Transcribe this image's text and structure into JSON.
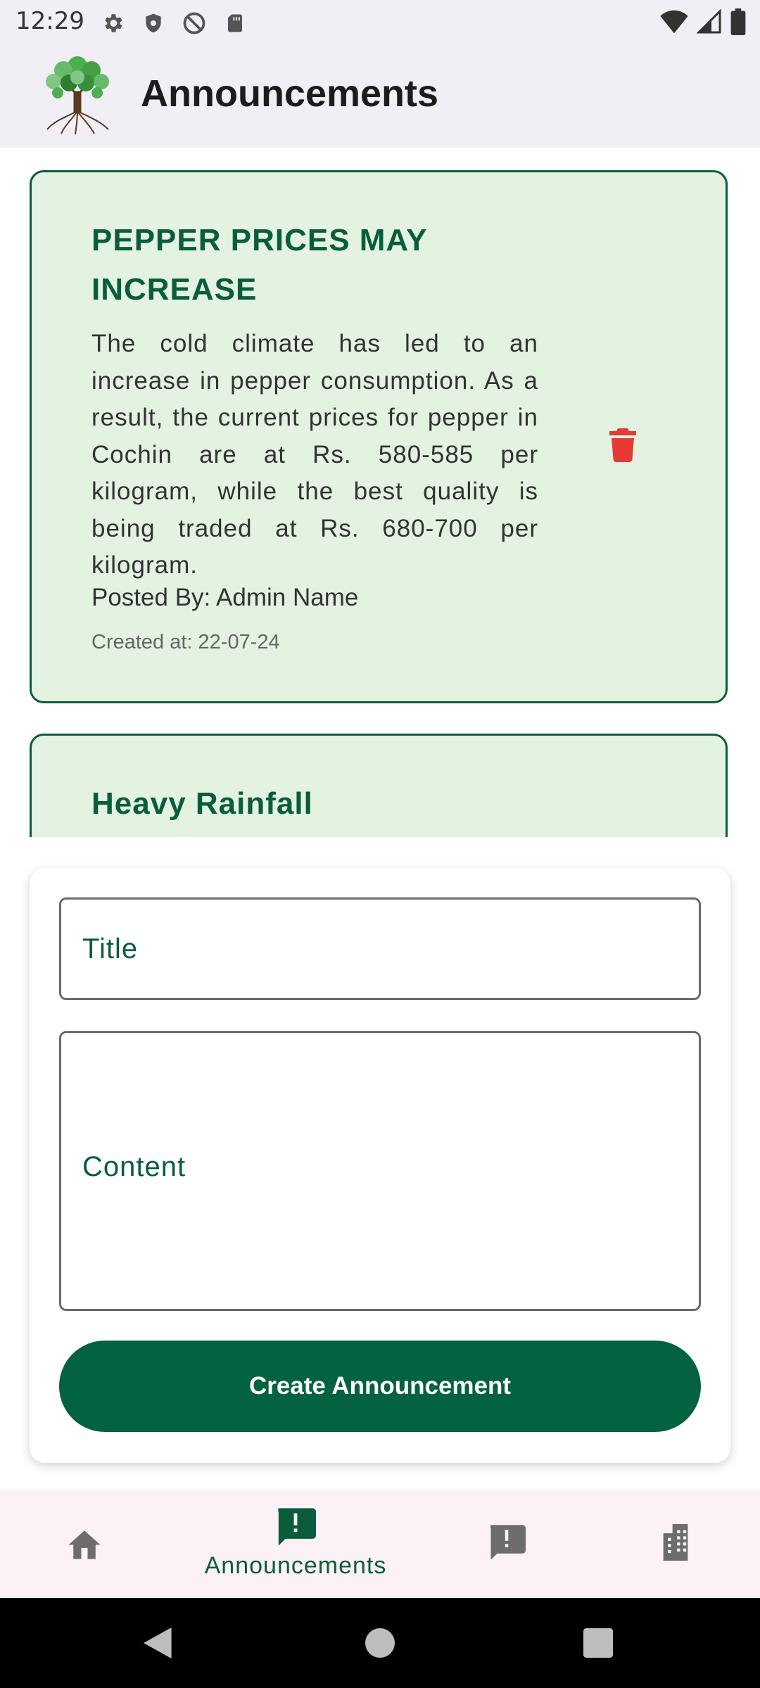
{
  "status_bar": {
    "time": "12:29",
    "left_icons": [
      "gear-icon",
      "shield-icon",
      "no-disturb-icon",
      "sd-card-icon"
    ],
    "right_icons": [
      "wifi-icon",
      "signal-icon",
      "battery-icon"
    ]
  },
  "app_bar": {
    "title": "Announcements",
    "logo": "tree-logo"
  },
  "announcements": [
    {
      "title": "PEPPER PRICES MAY INCREASE",
      "content": "The cold climate has led to an increase in pepper consumption. As a result, the current prices for pepper in Cochin are at Rs. 580-585 per kilogram, while the best quality is being traded at Rs. 680-700 per kilogram.",
      "posted_by": "Posted By: Admin Name",
      "created_at": "Created at: 22-07-24",
      "delete_icon": "trash-icon",
      "delete_color": "#e53935"
    },
    {
      "title": "Heavy Rainfall"
    }
  ],
  "form": {
    "title_placeholder": "Title",
    "title_value": "",
    "content_placeholder": "Content",
    "content_value": "",
    "submit_label": "Create Announcement"
  },
  "bottom_nav": {
    "items": [
      {
        "icon": "home-icon",
        "label": "",
        "active": false
      },
      {
        "icon": "announcement-icon",
        "label": "Announcements",
        "active": true
      },
      {
        "icon": "report-icon",
        "label": "",
        "active": false
      },
      {
        "icon": "organization-icon",
        "label": "",
        "active": false
      }
    ]
  },
  "system_nav": [
    "back-icon",
    "home-circle-icon",
    "recents-icon"
  ],
  "colors": {
    "primary": "#03623f",
    "card_bg": "#e3f2e1",
    "app_bar_bg": "#f1eff5",
    "nav_bg": "#fbf1f6",
    "delete": "#e53935"
  }
}
